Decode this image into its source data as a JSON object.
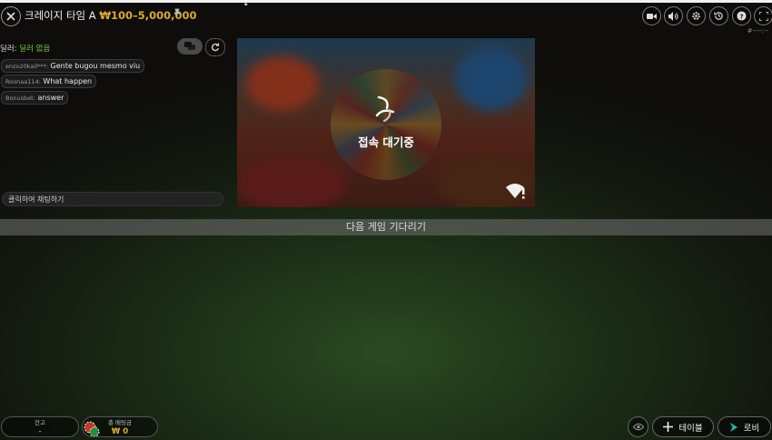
{
  "header": {
    "title": "크레이지 타임 A",
    "limits": "₩100–5,000,000"
  },
  "corner_text": "#----:--",
  "chat": {
    "status_label": "딜러:",
    "status_value": "딜러 없음",
    "messages": [
      {
        "user": "enzo20kail***:",
        "text": "Gente bugou mesmo viu"
      },
      {
        "user": "Roonaa114:",
        "text": "What happen"
      },
      {
        "user": "Bonusbet:",
        "text": "answer"
      }
    ],
    "input_placeholder": "클릭하여 채팅하기"
  },
  "video": {
    "status": "접속 대기중"
  },
  "banner": "다음 게임 기다리기",
  "footer": {
    "balance_label": "잔고",
    "balance_value": "-",
    "total_bet_label": "총 배팅금",
    "total_bet_value": "₩ 0",
    "table_button": "테이블",
    "lobby_button": "로비"
  },
  "colors": {
    "accent_gold": "#d8a93a",
    "dealer_green": "#79c244",
    "lobby_teal": "#2fb5a0"
  }
}
